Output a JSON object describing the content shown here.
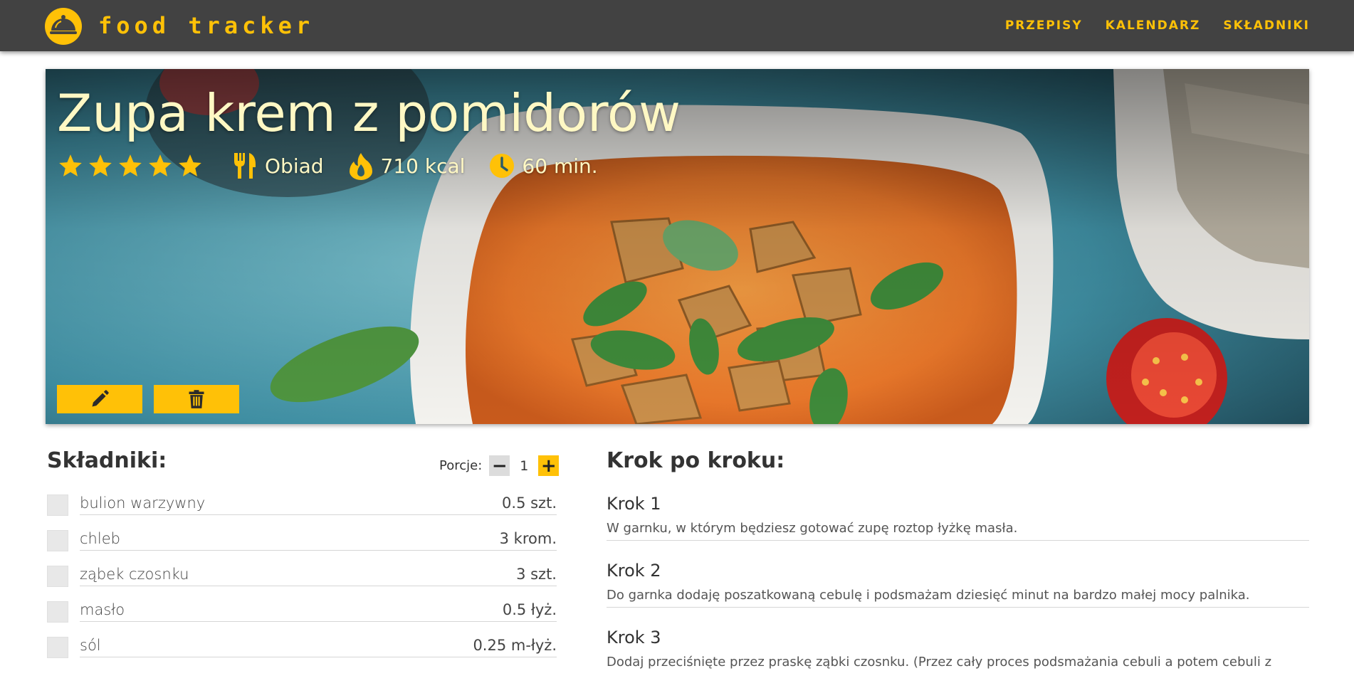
{
  "navbar": {
    "brand": "food tracker",
    "links": [
      "PRZEPISY",
      "KALENDARZ",
      "SKŁADNIKI"
    ]
  },
  "recipe": {
    "title": "Zupa krem z pomidorów",
    "rating": 5,
    "rating_max": 5,
    "category": "Obiad",
    "calories": "710 kcal",
    "time": "60 min."
  },
  "icons": {
    "logo": "cloche-icon",
    "category": "fork-knife-icon",
    "calories": "flame-icon",
    "time": "clock-icon",
    "edit": "pencil-icon",
    "delete": "trash-icon"
  },
  "colors": {
    "accent": "#ffc107",
    "navbar": "#424242",
    "hero_text": "#fff8c4"
  },
  "ingredients": {
    "title": "Składniki:",
    "portions_label": "Porcje:",
    "portions_value": "1",
    "minus_label": "−",
    "plus_label": "+",
    "items": [
      {
        "name": "bulion warzywny",
        "qty": "0.5 szt."
      },
      {
        "name": "chleb",
        "qty": "3 krom."
      },
      {
        "name": "ząbek czosnku",
        "qty": "3 szt."
      },
      {
        "name": "masło",
        "qty": "0.5 łyż."
      },
      {
        "name": "sól",
        "qty": "0.25 m-łyż."
      }
    ]
  },
  "steps": {
    "title": "Krok po kroku:",
    "items": [
      {
        "label": "Krok 1",
        "text": "W garnku, w którym będziesz gotować zupę roztop łyżkę masła."
      },
      {
        "label": "Krok 2",
        "text": "Do garnka dodaję poszatkowaną cebulę i podsmażam dziesięć minut na bardzo małej mocy palnika."
      },
      {
        "label": "Krok 3",
        "text": "Dodaj przeciśnięte przez praskę ząbki czosnku. (Przez cały proces podsmażania cebuli a potem cebuli z"
      }
    ]
  }
}
